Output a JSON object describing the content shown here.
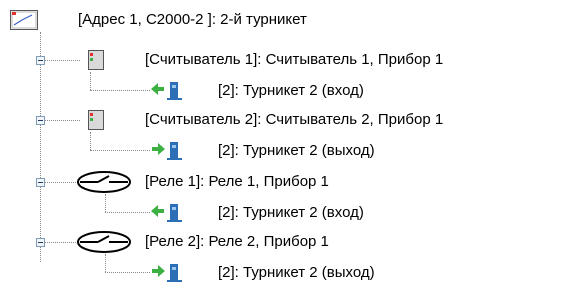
{
  "tree": {
    "root": {
      "label": "[Адрес 1, С2000-2 ]: 2-й турникет",
      "icon": "device-panel-icon"
    },
    "groups": [
      {
        "label": "[Считыватель 1]: Считыватель 1, Прибор 1",
        "icon": "reader-icon",
        "child": {
          "label": "[2]: Турникет 2 (вход)",
          "icon": "turnstile-entry-icon",
          "arrow_color": "#3cb043"
        }
      },
      {
        "label": "[Считыватель 2]: Считыватель 2, Прибор 1",
        "icon": "reader-icon",
        "child": {
          "label": "[2]: Турникет 2 (выход)",
          "icon": "turnstile-exit-icon",
          "arrow_color": "#3cb043"
        }
      },
      {
        "label": "[Реле 1]: Реле 1, Прибор 1",
        "icon": "relay-icon",
        "child": {
          "label": "[2]: Турникет 2 (вход)",
          "icon": "turnstile-entry-icon",
          "arrow_color": "#3cb043"
        }
      },
      {
        "label": "[Реле 2]: Реле 2, Прибор 1",
        "icon": "relay-icon",
        "child": {
          "label": "[2]: Турникет 2 (выход)",
          "icon": "turnstile-exit-icon",
          "arrow_color": "#3cb043"
        }
      }
    ]
  },
  "colors": {
    "selection": "#ffffff",
    "connector": "#8a8a8a",
    "expander_border": "#7f9db9",
    "reader_led": "#e03030",
    "turnstile_body": "#2d6fb7"
  }
}
